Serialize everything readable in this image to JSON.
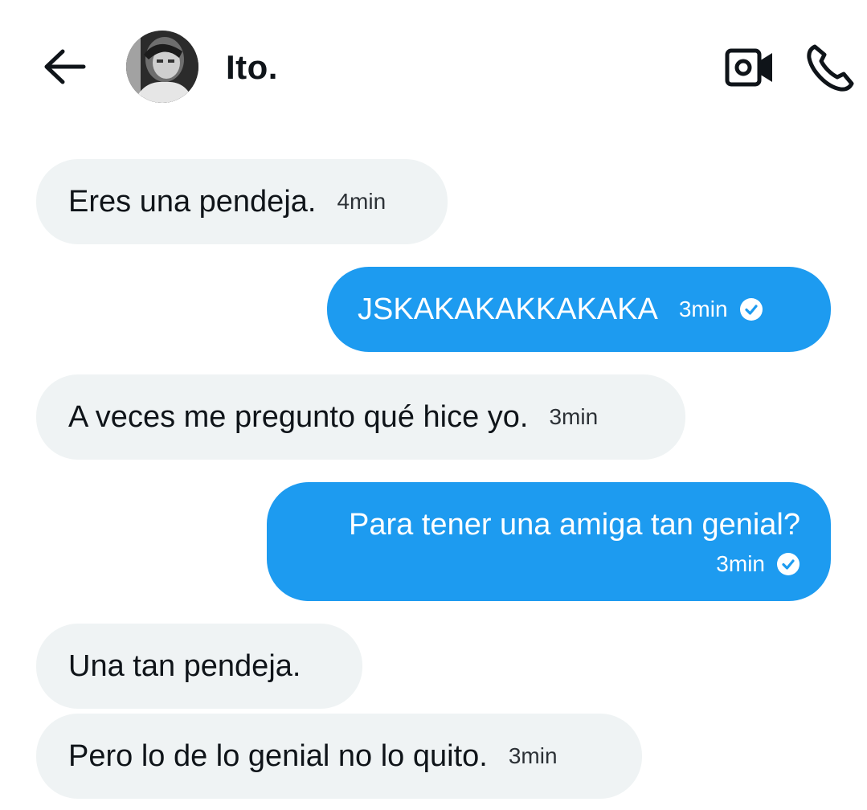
{
  "header": {
    "back_icon": "arrow-left-icon",
    "contact_name": "Ito.",
    "video_icon": "video-camera-icon",
    "call_icon": "phone-icon"
  },
  "colors": {
    "outgoing_bubble": "#1d9bf0",
    "incoming_bubble": "#eff3f4",
    "text": "#0f1419"
  },
  "messages": [
    {
      "direction": "in",
      "text": "Eres una pendeja.",
      "time": "4min"
    },
    {
      "direction": "out",
      "text": "JSKAKAKAKKAKAKA",
      "time": "3min",
      "status_icon": "check-circle-icon"
    },
    {
      "direction": "in",
      "text": "A veces me pregunto qué hice yo.",
      "time": "3min"
    },
    {
      "direction": "out",
      "text": "Para tener una amiga tan genial?",
      "time": "3min",
      "status_icon": "check-circle-icon"
    },
    {
      "direction": "in",
      "text": "Una tan pendeja.",
      "time": ""
    },
    {
      "direction": "in",
      "text": "Pero lo de lo genial no lo quito.",
      "time": "3min"
    }
  ]
}
